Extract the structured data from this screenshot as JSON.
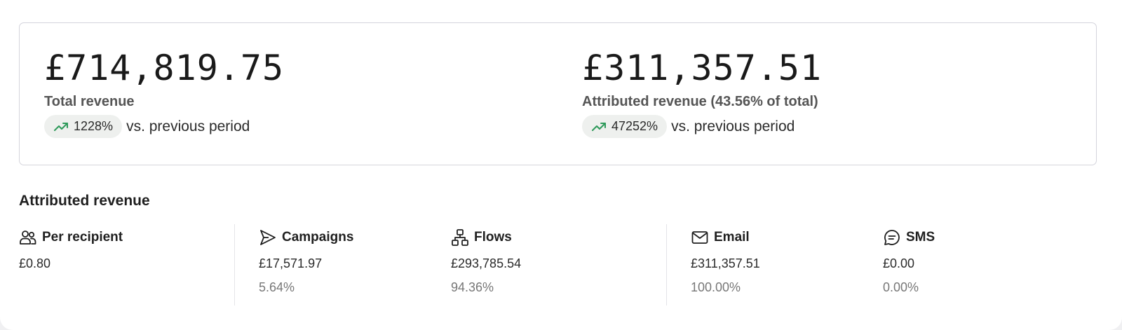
{
  "summary": {
    "total": {
      "amount": "£714,819.75",
      "label": "Total revenue",
      "change": "1228%",
      "comparison": "vs. previous period"
    },
    "attributed": {
      "amount": "£311,357.51",
      "label": "Attributed revenue (43.56% of total)",
      "change": "47252%",
      "comparison": "vs. previous period"
    }
  },
  "breakdown": {
    "title": "Attributed revenue",
    "columns": [
      {
        "icon": "users-icon",
        "title": "Per recipient",
        "value": "£0.80",
        "percent": ""
      },
      {
        "icon": "send-icon",
        "title": "Campaigns",
        "value": "£17,571.97",
        "percent": "5.64%"
      },
      {
        "icon": "flows-icon",
        "title": "Flows",
        "value": "£293,785.54",
        "percent": "94.36%"
      },
      {
        "icon": "mail-icon",
        "title": "Email",
        "value": "£311,357.51",
        "percent": "100.00%"
      },
      {
        "icon": "chat-icon",
        "title": "SMS",
        "value": "£0.00",
        "percent": "0.00%"
      }
    ]
  },
  "colors": {
    "trend_up": "#2e9a5a",
    "pill_bg": "#eef0ee",
    "border": "#d4d4dc"
  }
}
